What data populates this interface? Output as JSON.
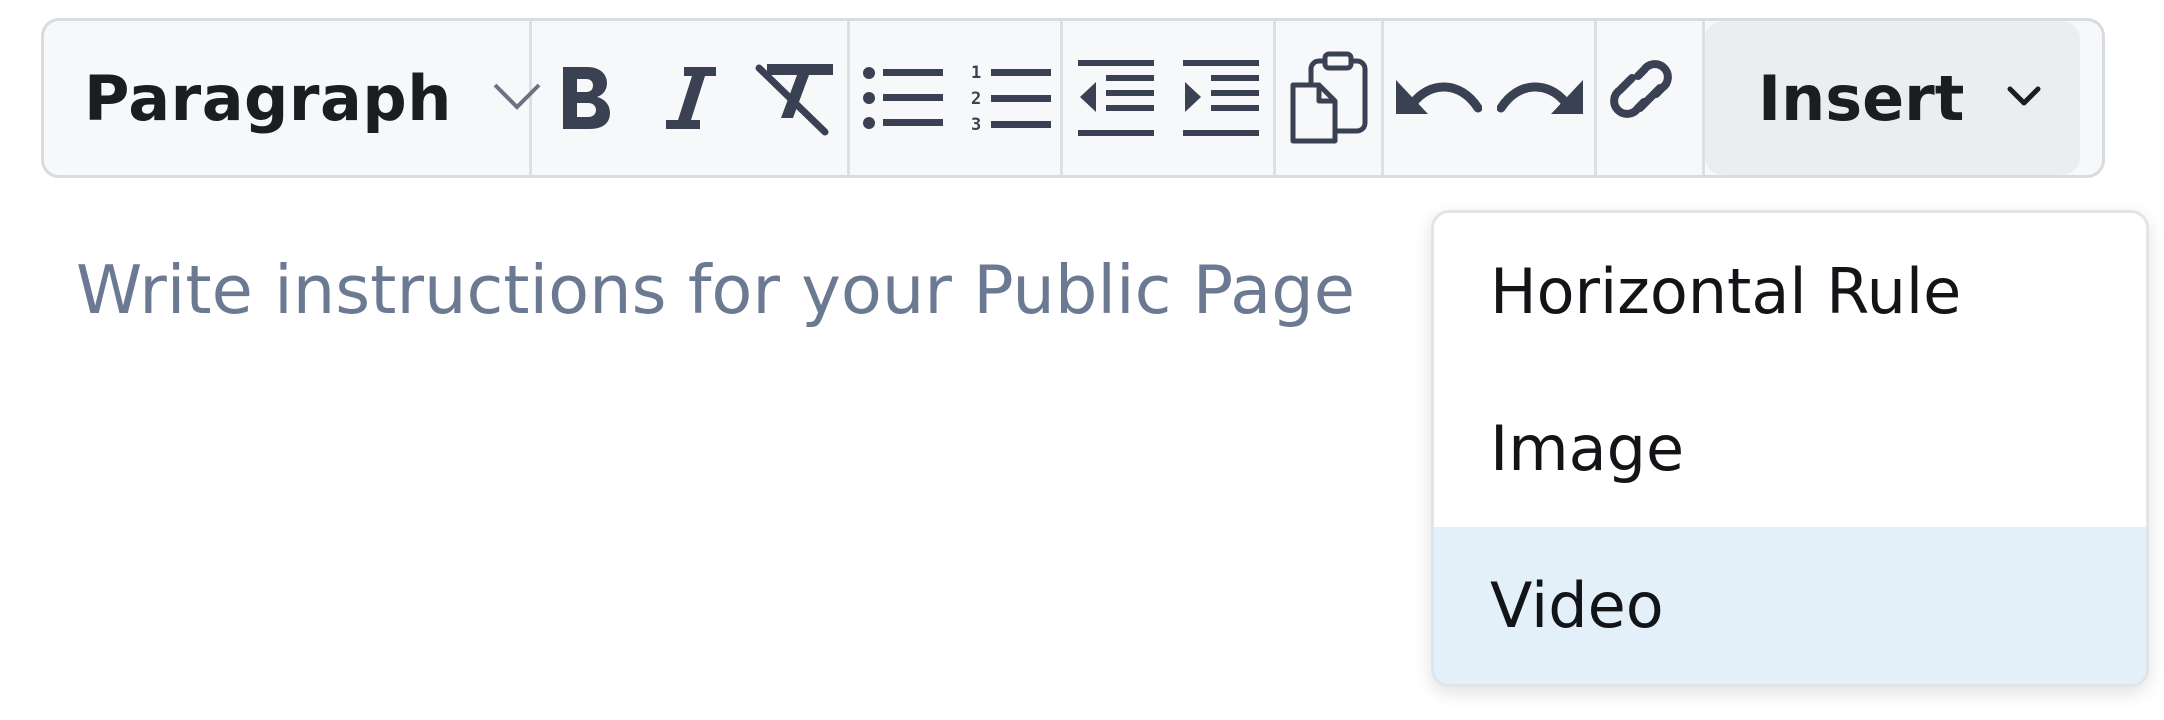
{
  "toolbar": {
    "block_format": {
      "label": "Paragraph",
      "icon": "chevron-down-icon"
    },
    "buttons": [
      {
        "name": "bold",
        "icon": "bold-icon"
      },
      {
        "name": "italic",
        "icon": "italic-icon"
      },
      {
        "name": "clear-formatting",
        "icon": "clear-format-icon"
      },
      {
        "name": "bullet-list",
        "icon": "bullet-list-icon"
      },
      {
        "name": "numbered-list",
        "icon": "numbered-list-icon"
      },
      {
        "name": "outdent",
        "icon": "outdent-icon"
      },
      {
        "name": "indent",
        "icon": "indent-icon"
      },
      {
        "name": "paste",
        "icon": "paste-icon"
      },
      {
        "name": "undo",
        "icon": "undo-icon"
      },
      {
        "name": "redo",
        "icon": "redo-icon"
      },
      {
        "name": "link",
        "icon": "link-icon"
      }
    ],
    "insert": {
      "label": "Insert",
      "icon": "chevron-down-icon"
    }
  },
  "editor": {
    "placeholder": "Write instructions for your Public Page"
  },
  "insert_menu": {
    "items": [
      {
        "label": "Horizontal Rule",
        "highlighted": false
      },
      {
        "label": "Image",
        "highlighted": false
      },
      {
        "label": "Video",
        "highlighted": true
      }
    ]
  },
  "colors": {
    "icon": "#3a4152",
    "placeholder": "#6b7a92",
    "highlight": "#e3f0fa",
    "toolbar_bg": "#f7f8fa",
    "insert_bg": "#ebedf0"
  }
}
